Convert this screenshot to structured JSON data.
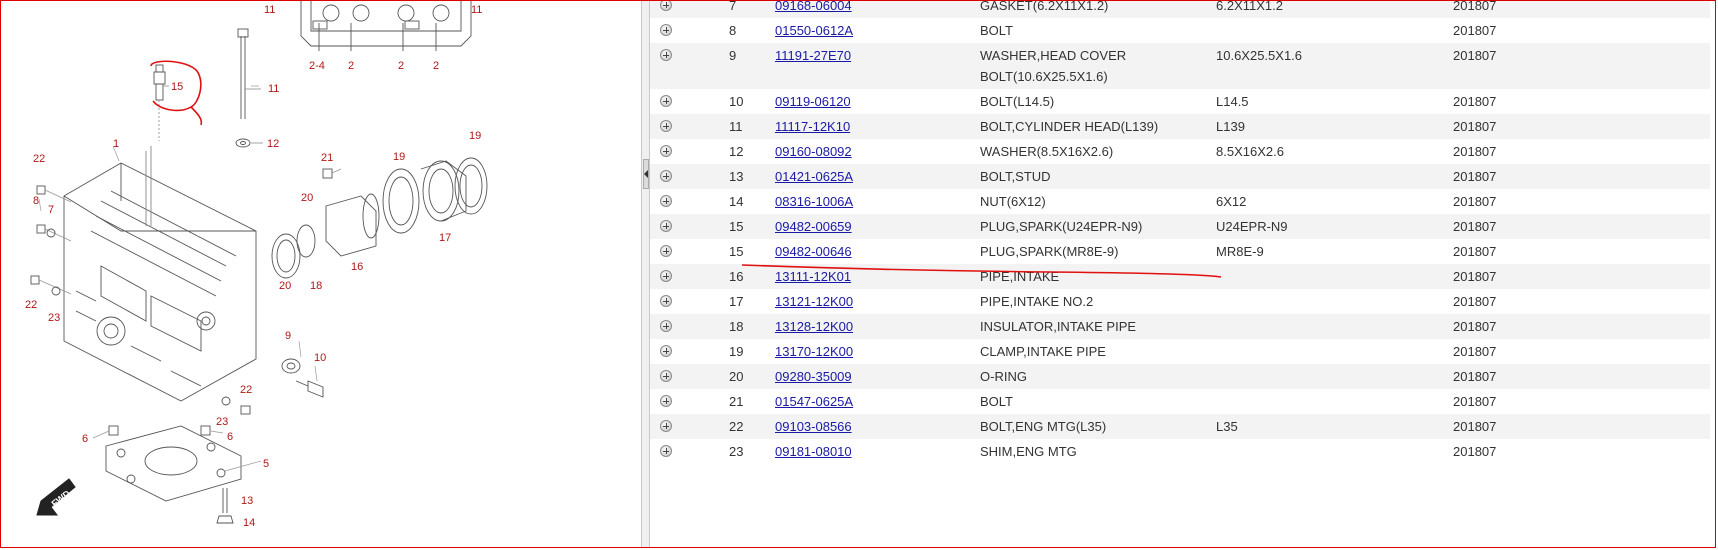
{
  "colors": {
    "callout": "#b01818",
    "link": "#1a1aa6",
    "markup": "#e01010"
  },
  "diagram": {
    "callouts": {
      "c1": "1",
      "c2a": "2",
      "c2b": "2",
      "c2c": "2",
      "c24": "2-4",
      "c5": "5",
      "c6a": "6",
      "c6b": "6",
      "c7": "7",
      "c8": "8",
      "c9": "9",
      "c10": "10",
      "c11a": "11",
      "c11b": "11",
      "c11c": "11",
      "c12": "12",
      "c13": "13",
      "c14": "14",
      "c15": "15",
      "c16": "16",
      "c17": "17",
      "c18": "18",
      "c19a": "19",
      "c19b": "19",
      "c20a": "20",
      "c20b": "20",
      "c21": "21",
      "c22a": "22",
      "c22b": "22",
      "c22c": "22",
      "c23a": "23",
      "c23b": "23"
    },
    "fwd_label": "FWD"
  },
  "parts": [
    {
      "no": "7",
      "part_number": "09168-06004",
      "description": "GASKET(6.2X11X1.2)",
      "spec": "6.2X11X1.2",
      "date": "201807"
    },
    {
      "no": "8",
      "part_number": "01550-0612A",
      "description": "BOLT",
      "spec": "",
      "date": "201807"
    },
    {
      "no": "9",
      "part_number": "11191-27E70",
      "description": "WASHER,HEAD COVER BOLT(10.6X25.5X1.6)",
      "spec": "10.6X25.5X1.6",
      "date": "201807"
    },
    {
      "no": "10",
      "part_number": "09119-06120",
      "description": "BOLT(L14.5)",
      "spec": "L14.5",
      "date": "201807"
    },
    {
      "no": "11",
      "part_number": "11117-12K10",
      "description": "BOLT,CYLINDER HEAD(L139)",
      "spec": "L139",
      "date": "201807"
    },
    {
      "no": "12",
      "part_number": "09160-08092",
      "description": "WASHER(8.5X16X2.6)",
      "spec": "8.5X16X2.6",
      "date": "201807"
    },
    {
      "no": "13",
      "part_number": "01421-0625A",
      "description": "BOLT,STUD",
      "spec": "",
      "date": "201807"
    },
    {
      "no": "14",
      "part_number": "08316-1006A",
      "description": "NUT(6X12)",
      "spec": "6X12",
      "date": "201807"
    },
    {
      "no": "15",
      "part_number": "09482-00659",
      "description": "PLUG,SPARK(U24EPR-N9)",
      "spec": "U24EPR-N9",
      "date": "201807"
    },
    {
      "no": "15",
      "part_number": "09482-00646",
      "description": "PLUG,SPARK(MR8E-9)",
      "spec": "MR8E-9",
      "date": "201807"
    },
    {
      "no": "16",
      "part_number": "13111-12K01",
      "description": "PIPE,INTAKE",
      "spec": "",
      "date": "201807"
    },
    {
      "no": "17",
      "part_number": "13121-12K00",
      "description": "PIPE,INTAKE NO.2",
      "spec": "",
      "date": "201807"
    },
    {
      "no": "18",
      "part_number": "13128-12K00",
      "description": "INSULATOR,INTAKE PIPE",
      "spec": "",
      "date": "201807"
    },
    {
      "no": "19",
      "part_number": "13170-12K00",
      "description": "CLAMP,INTAKE PIPE",
      "spec": "",
      "date": "201807"
    },
    {
      "no": "20",
      "part_number": "09280-35009",
      "description": "O-RING",
      "spec": "",
      "date": "201807"
    },
    {
      "no": "21",
      "part_number": "01547-0625A",
      "description": "BOLT",
      "spec": "",
      "date": "201807"
    },
    {
      "no": "22",
      "part_number": "09103-08566",
      "description": "BOLT,ENG MTG(L35)",
      "spec": "L35",
      "date": "201807"
    },
    {
      "no": "23",
      "part_number": "09181-08010",
      "description": "SHIM,ENG MTG",
      "spec": "",
      "date": "201807"
    }
  ]
}
